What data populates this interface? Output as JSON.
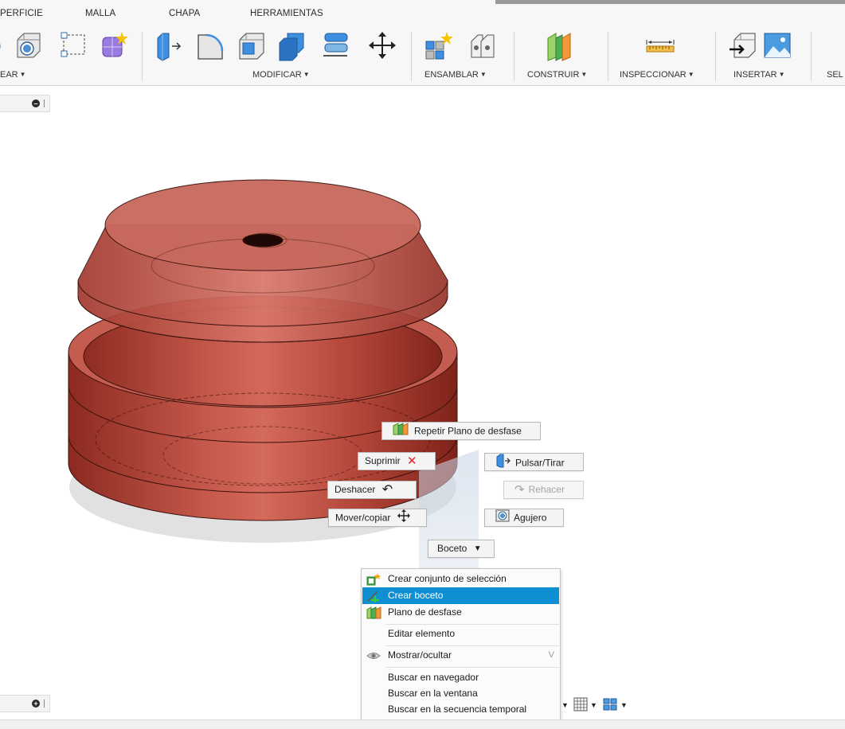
{
  "toolbar": {
    "tabs": [
      "PERFICIE",
      "MALLA",
      "CHAPA",
      "HERRAMIENTAS"
    ],
    "groups": {
      "crear": "EAR",
      "modificar": "MODIFICAR",
      "ensamblar": "ENSAMBLAR",
      "construir": "CONSTRUIR",
      "inspeccionar": "INSPECCIONAR",
      "insertar": "INSERTAR",
      "seleccionar": "SEL"
    },
    "icons": [
      "revolve-icon",
      "hole-icon",
      "sketch-rectangle-icon",
      "form-icon",
      "press-pull-icon",
      "fillet-icon",
      "shell-icon",
      "combine-icon",
      "offset-face-icon",
      "move-copy-icon",
      "new-component-icon",
      "joint-icon",
      "offset-plane-icon",
      "measure-icon",
      "insert-derive-icon",
      "insert-image-icon"
    ]
  },
  "marking_menu": {
    "repeat": "Repetir Plano de desfase",
    "delete": "Suprimir",
    "press_pull": "Pulsar/Tirar",
    "undo": "Deshacer",
    "redo": "Rehacer",
    "move_copy": "Mover/copiar",
    "hole": "Agujero",
    "sketch": "Boceto"
  },
  "context_menu": {
    "items": [
      {
        "label": "Crear conjunto de selección",
        "icon": "selection-set-icon"
      },
      {
        "label": "Crear boceto",
        "icon": "sketch-create-icon",
        "highlighted": true
      },
      {
        "label": "Plano de desfase",
        "icon": "offset-plane-icon"
      },
      {
        "label": "Editar elemento"
      },
      {
        "label": "Mostrar/ocultar",
        "icon": "eye-icon",
        "shortcut": "V"
      },
      {
        "label": "Buscar en navegador"
      },
      {
        "label": "Buscar en la ventana"
      },
      {
        "label": "Buscar en la secuencia temporal"
      }
    ]
  },
  "colors": {
    "highlight": "#0e8fd3",
    "model_body": "#b84a3c",
    "delete_red": "#e0242a"
  }
}
